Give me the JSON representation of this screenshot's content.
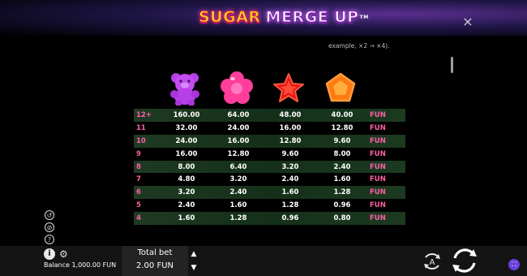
{
  "header": {
    "logo_word1": "SUGAR",
    "logo_word2": "MERGE UP",
    "logo_tm": "TM",
    "close_icon": "×"
  },
  "paytable": {
    "note": "example, ×2 → ×4).",
    "symbols": [
      "purple-bear-icon",
      "pink-flower-candy-icon",
      "red-star-candy-icon",
      "orange-pentagon-candy-icon"
    ],
    "rows": [
      {
        "label": "12+",
        "values": [
          "160.00",
          "64.00",
          "48.00",
          "40.00"
        ],
        "currency": "FUN"
      },
      {
        "label": "11",
        "values": [
          "32.00",
          "24.00",
          "16.00",
          "12.80"
        ],
        "currency": "FUN"
      },
      {
        "label": "10",
        "values": [
          "24.00",
          "16.00",
          "12.80",
          "9.60"
        ],
        "currency": "FUN"
      },
      {
        "label": "9",
        "values": [
          "16.00",
          "12.80",
          "9.60",
          "8.00"
        ],
        "currency": "FUN"
      },
      {
        "label": "8",
        "values": [
          "8.00",
          "6.40",
          "3.20",
          "2.40"
        ],
        "currency": "FUN"
      },
      {
        "label": "7",
        "values": [
          "4.80",
          "3.20",
          "2.40",
          "1.60"
        ],
        "currency": "FUN"
      },
      {
        "label": "6",
        "values": [
          "3.20",
          "2.40",
          "1.60",
          "1.28"
        ],
        "currency": "FUN"
      },
      {
        "label": "5",
        "values": [
          "2.40",
          "1.60",
          "1.28",
          "0.96"
        ],
        "currency": "FUN"
      },
      {
        "label": "4",
        "values": [
          "1.60",
          "1.28",
          "0.96",
          "0.80"
        ],
        "currency": "FUN"
      }
    ]
  },
  "side_icons": [
    "history-icon",
    "responsible-gaming-icon",
    "help-icon"
  ],
  "bottom": {
    "info_icon": "i",
    "balance_label": "Balance",
    "balance_value": "1,000.00 FUN",
    "total_bet_label": "Total bet",
    "total_bet_value": "2.00 FUN",
    "bet_up_icon": "▲",
    "bet_down_icon": "▼",
    "autoplay_label": "A"
  },
  "colors": {
    "accent_pink": "#ff5fa8",
    "row_green": "#1f3a22",
    "fullscreen_purple": "#6a3fd8"
  }
}
